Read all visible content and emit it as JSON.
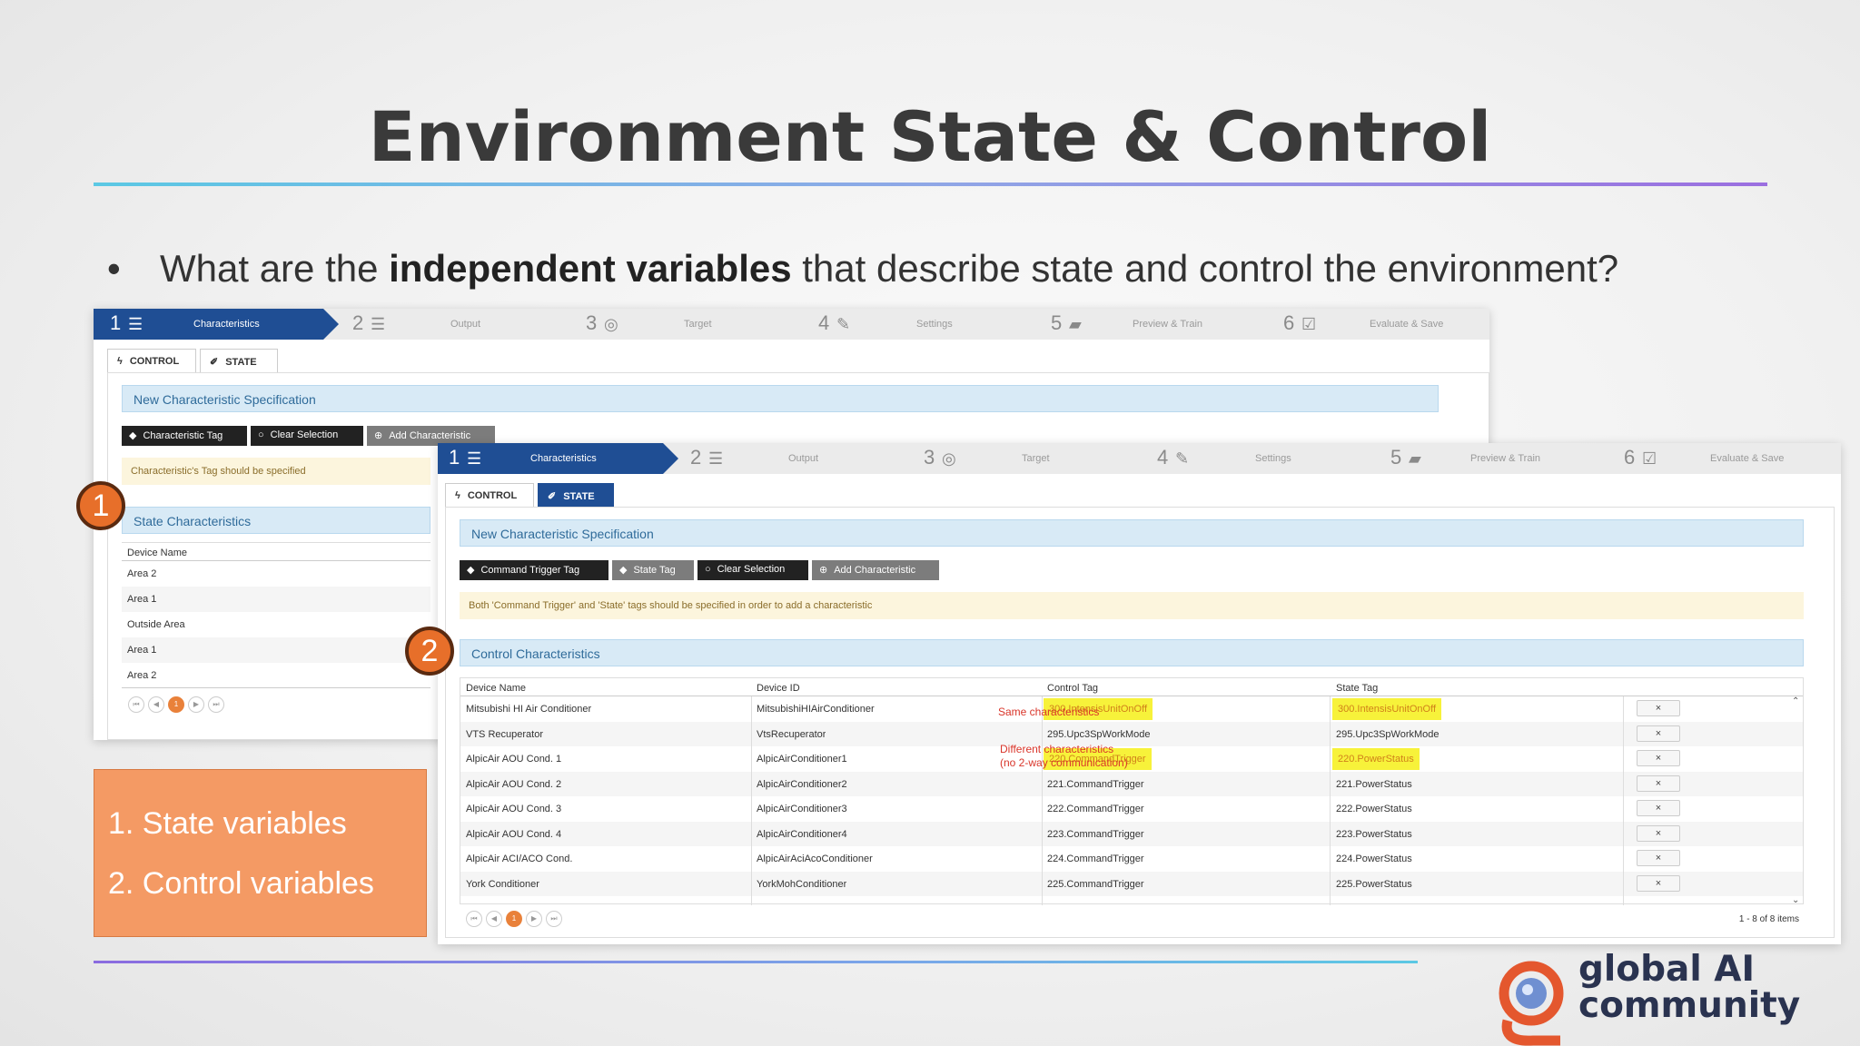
{
  "slide": {
    "title": "Environment State & Control",
    "bullet_prefix": "What are the ",
    "bullet_bold": "independent variables",
    "bullet_suffix": " that describe state and control the environment?"
  },
  "markers": [
    "1",
    "2"
  ],
  "wizard_steps": [
    {
      "num": "1",
      "label": "Characteristics",
      "icon": "list-icon"
    },
    {
      "num": "2",
      "label": "Output",
      "icon": "list-icon"
    },
    {
      "num": "3",
      "label": "Target",
      "icon": "target-icon"
    },
    {
      "num": "4",
      "label": "Settings",
      "icon": "wrench-icon"
    },
    {
      "num": "5",
      "label": "Preview & Train",
      "icon": "graduation-cap-icon"
    },
    {
      "num": "6",
      "label": "Evaluate & Save",
      "icon": "checkbox-icon"
    }
  ],
  "tabs": {
    "control": "CONTROL",
    "state": "STATE"
  },
  "state_screen": {
    "section_title": "New Characteristic Specification",
    "buttons": {
      "tag": "Characteristic Tag",
      "clear": "Clear Selection",
      "add": "Add Characteristic"
    },
    "warning": "Characteristic's Tag should be specified",
    "list_title": "State Characteristics",
    "column": "Device Name",
    "rows": [
      "Area 2",
      "Area 1",
      "Outside Area",
      "Area 1",
      "Area 2"
    ],
    "current_page": "1"
  },
  "control_screen": {
    "section_title": "New Characteristic Specification",
    "buttons": {
      "command": "Command Trigger Tag",
      "state": "State Tag",
      "clear": "Clear Selection",
      "add": "Add Characteristic"
    },
    "warning": "Both 'Command Trigger' and 'State' tags should be specified in order to add a characteristic",
    "list_title": "Control Characteristics",
    "columns": {
      "device_name": "Device Name",
      "device_id": "Device ID",
      "control_tag": "Control Tag",
      "state_tag": "State Tag"
    },
    "rows": [
      {
        "name": "Mitsubishi HI Air Conditioner",
        "id": "MitsubishiHIAirConditioner",
        "control": "300.IntensisUnitOnOff",
        "state": "300.IntensisUnitOnOff"
      },
      {
        "name": "VTS Recuperator",
        "id": "VtsRecuperator",
        "control": "295.Upc3SpWorkMode",
        "state": "295.Upc3SpWorkMode"
      },
      {
        "name": "AlpicAir AOU Cond. 1",
        "id": "AlpicAirConditioner1",
        "control": "220.CommandTrigger",
        "state": "220.PowerStatus"
      },
      {
        "name": "AlpicAir AOU Cond. 2",
        "id": "AlpicAirConditioner2",
        "control": "221.CommandTrigger",
        "state": "221.PowerStatus"
      },
      {
        "name": "AlpicAir AOU Cond. 3",
        "id": "AlpicAirConditioner3",
        "control": "222.CommandTrigger",
        "state": "222.PowerStatus"
      },
      {
        "name": "AlpicAir AOU Cond. 4",
        "id": "AlpicAirConditioner4",
        "control": "223.CommandTrigger",
        "state": "223.PowerStatus"
      },
      {
        "name": "AlpicAir ACI/ACO Cond.",
        "id": "AlpicAirAciAcoConditioner",
        "control": "224.CommandTrigger",
        "state": "224.PowerStatus"
      },
      {
        "name": "York Conditioner",
        "id": "YorkMohConditioner",
        "control": "225.CommandTrigger",
        "state": "225.PowerStatus"
      }
    ],
    "delete_symbol": "×",
    "current_page": "1",
    "items_summary": "1 - 8 of 8 items"
  },
  "annotations": {
    "same": "Same characteristics",
    "different_line1": "Different characteristics",
    "different_line2": "(no 2-way communication)"
  },
  "legend": [
    "1.   State variables",
    "2.   Control variables"
  ],
  "logo": {
    "line1": "global AI",
    "line2": "community"
  },
  "colors": {
    "highlight": "#f7f23a",
    "accent_orange": "#e9813a",
    "wizard_blue": "#1f4e94",
    "note_red": "#d9352a",
    "legend_orange": "#f49a64"
  }
}
